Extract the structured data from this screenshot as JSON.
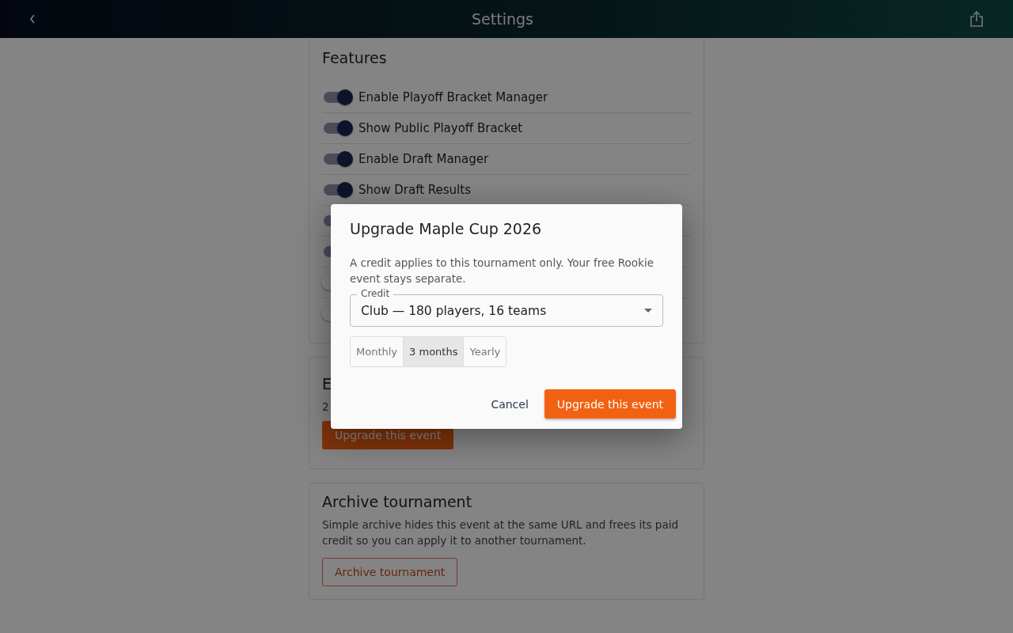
{
  "header": {
    "title": "Settings"
  },
  "features": {
    "title": "Features",
    "items": [
      {
        "label": "Enable Playoff Bracket Manager",
        "on": true
      },
      {
        "label": "Show Public Playoff Bracket",
        "on": true
      },
      {
        "label": "Enable Draft Manager",
        "on": true
      },
      {
        "label": "Show Draft Results",
        "on": true
      },
      {
        "on": true
      },
      {
        "on": true
      },
      {
        "on": false
      },
      {
        "on": false
      }
    ]
  },
  "event": {
    "title": "E",
    "text": "2",
    "button": "Upgrade this event"
  },
  "archive": {
    "title": "Archive tournament",
    "text": "Simple archive hides this event at the same URL and frees its paid credit so you can apply it to another tournament.",
    "button": "Archive tournament"
  },
  "dialog": {
    "title": "Upgrade Maple Cup 2026",
    "text": "A credit applies to this tournament only. Your free Rookie event stays separate.",
    "credit_label": "Credit",
    "credit_value": "Club — 180 players, 16 teams",
    "periods": [
      {
        "label": "Monthly",
        "selected": false
      },
      {
        "label": "3 months",
        "selected": true
      },
      {
        "label": "Yearly",
        "selected": false
      }
    ],
    "cancel": "Cancel",
    "confirm": "Upgrade this event"
  }
}
